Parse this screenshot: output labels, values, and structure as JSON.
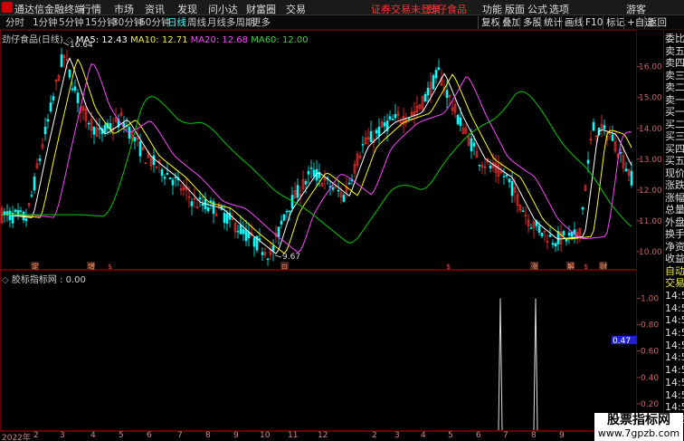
{
  "titlebar": {
    "app_name": "通达信金融终端",
    "menus": [
      "行情",
      "市场",
      "资讯",
      "发现",
      "问小达",
      "财富圈",
      "交易"
    ],
    "notice_login": "证券交易未登录",
    "notice_stock": "劲仔食品",
    "right_menus": [
      "功能",
      "版面",
      "公式",
      "选项"
    ],
    "guest": "游客"
  },
  "tabs": {
    "periods": [
      "分时",
      "1分钟",
      "5分钟",
      "15分钟",
      "30分钟",
      "60分钟",
      "日线",
      "周线",
      "月线",
      "多周期",
      "更多"
    ],
    "active": "日线",
    "right_buttons": [
      "复权",
      "叠加",
      "多股",
      "统计",
      "画线",
      "F10",
      "标记",
      "+自选",
      "返回"
    ]
  },
  "main_chart": {
    "stock_title": "劲仔食品(日线)",
    "ma5_label": "MA5: 12.43",
    "ma10_label": "MA10: 12.71",
    "ma20_label": "MA20: 12.68",
    "ma60_label": "MA60: 12.00",
    "high_label": "16.64",
    "low_label": "9.67",
    "colors": {
      "ma5": "#ffffff",
      "ma10": "#ffff00",
      "ma20": "#ff44ff",
      "ma60": "#00cc00",
      "up": "#ff3333",
      "down": "#00ffff"
    }
  },
  "event_tags": [
    {
      "label": "定",
      "x": 38
    },
    {
      "label": "增",
      "x": 100
    },
    {
      "label": "$",
      "x": 122
    },
    {
      "label": "⊡",
      "x": 314
    },
    {
      "label": "$",
      "x": 496
    },
    {
      "label": "涨",
      "x": 590
    },
    {
      "label": "解",
      "x": 630
    },
    {
      "label": "$",
      "x": 648
    },
    {
      "label": "财",
      "x": 666
    }
  ],
  "indicator": {
    "title": "胶标指标网 : 0.00",
    "current_value": "0.47"
  },
  "chart_data": [
    {
      "type": "line",
      "title": "劲仔食品(日线)",
      "y_ticks": [
        "16.00",
        "15.00",
        "14.00",
        "13.00",
        "12.00",
        "11.00",
        "10.00"
      ],
      "ylim": [
        9.5,
        16.9
      ],
      "series": [
        {
          "name": "MA5",
          "values": [
            12.43
          ]
        },
        {
          "name": "MA10",
          "values": [
            12.71
          ]
        },
        {
          "name": "MA20",
          "values": [
            12.68
          ]
        },
        {
          "name": "MA60",
          "values": [
            12.0
          ]
        }
      ],
      "annotations": [
        "16.64",
        "9.67"
      ]
    },
    {
      "type": "bar",
      "title": "胶标指标网 : 0.00",
      "y_ticks": [
        "1.00",
        "0.80",
        "0.60",
        "0.40",
        "0.20"
      ],
      "ylim": [
        0,
        1.1
      ],
      "spikes": [
        1.0,
        1.0
      ]
    }
  ],
  "x_axis": {
    "labels": [
      "2022年",
      "2",
      "3",
      "4",
      "5",
      "6",
      "7",
      "8",
      "9",
      "10",
      "11",
      "12",
      "2",
      "3",
      "4",
      "5",
      "6",
      "7",
      "8",
      "9"
    ]
  },
  "sidebar": {
    "labels": [
      "委比",
      "卖五",
      "卖四",
      "卖三",
      "卖二",
      "卖一",
      "买一",
      "买二",
      "买三",
      "买四",
      "买五",
      "现价",
      "涨跌",
      "涨幅",
      "总量",
      "外盘",
      "换手",
      "净资",
      "收益"
    ],
    "label2": [
      "自动",
      "交易"
    ],
    "times": [
      "14:56",
      "14:56",
      "14:56",
      "14:56",
      "14:56",
      "14:56",
      "14:56",
      "14:56",
      "14:56",
      "14:56",
      "14:56"
    ]
  },
  "watermark": {
    "line1": "股票指标网",
    "line2": "www.7gpzb.com"
  }
}
